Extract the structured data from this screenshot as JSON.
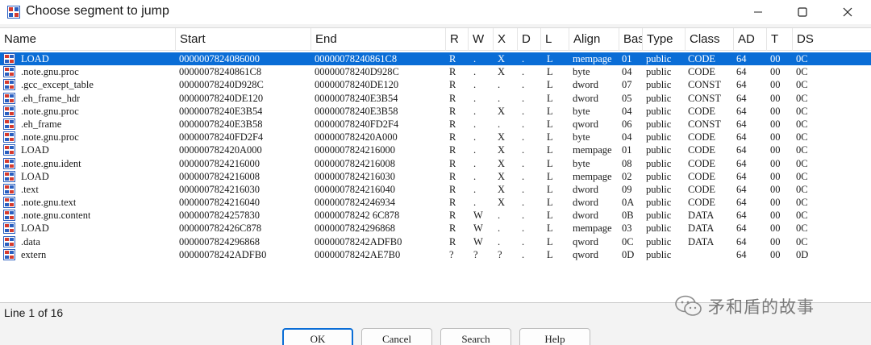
{
  "window": {
    "title": "Choose segment to jump"
  },
  "columns": [
    "Name",
    "Start",
    "End",
    "R",
    "W",
    "X",
    "D",
    "L",
    "Align",
    "Bas",
    "Type",
    "Class",
    "AD",
    "T",
    "DS"
  ],
  "rows": [
    [
      "LOAD",
      "0000007824086000",
      "00000078240861C8",
      "R",
      ".",
      "X",
      ".",
      "L",
      "mempage",
      "01",
      "public",
      "CODE",
      "64",
      "00",
      "0C"
    ],
    [
      ".note.gnu.proc",
      "00000078240861C8",
      "00000078240D928C",
      "R",
      ".",
      "X",
      ".",
      "L",
      "byte",
      "04",
      "public",
      "CODE",
      "64",
      "00",
      "0C"
    ],
    [
      ".gcc_except_table",
      "00000078240D928C",
      "00000078240DE120",
      "R",
      ".",
      ".",
      ".",
      "L",
      "dword",
      "07",
      "public",
      "CONST",
      "64",
      "00",
      "0C"
    ],
    [
      ".eh_frame_hdr",
      "00000078240DE120",
      "00000078240E3B54",
      "R",
      ".",
      ".",
      ".",
      "L",
      "dword",
      "05",
      "public",
      "CONST",
      "64",
      "00",
      "0C"
    ],
    [
      ".note.gnu.proc",
      "00000078240E3B54",
      "00000078240E3B58",
      "R",
      ".",
      "X",
      ".",
      "L",
      "byte",
      "04",
      "public",
      "CODE",
      "64",
      "00",
      "0C"
    ],
    [
      ".eh_frame",
      "00000078240E3B58",
      "00000078240FD2F4",
      "R",
      ".",
      ".",
      ".",
      "L",
      "qword",
      "06",
      "public",
      "CONST",
      "64",
      "00",
      "0C"
    ],
    [
      ".note.gnu.proc",
      "00000078240FD2F4",
      "000000782420A000",
      "R",
      ".",
      "X",
      ".",
      "L",
      "byte",
      "04",
      "public",
      "CODE",
      "64",
      "00",
      "0C"
    ],
    [
      "LOAD",
      "000000782420A000",
      "0000007824216000",
      "R",
      ".",
      "X",
      ".",
      "L",
      "mempage",
      "01",
      "public",
      "CODE",
      "64",
      "00",
      "0C"
    ],
    [
      ".note.gnu.ident",
      "0000007824216000",
      "0000007824216008",
      "R",
      ".",
      "X",
      ".",
      "L",
      "byte",
      "08",
      "public",
      "CODE",
      "64",
      "00",
      "0C"
    ],
    [
      "LOAD",
      "0000007824216008",
      "0000007824216030",
      "R",
      ".",
      "X",
      ".",
      "L",
      "mempage",
      "02",
      "public",
      "CODE",
      "64",
      "00",
      "0C"
    ],
    [
      ".text",
      "0000007824216030",
      "0000007824216040",
      "R",
      ".",
      "X",
      ".",
      "L",
      "dword",
      "09",
      "public",
      "CODE",
      "64",
      "00",
      "0C"
    ],
    [
      ".note.gnu.text",
      "0000007824216040",
      "0000007824246934",
      "R",
      ".",
      "X",
      ".",
      "L",
      "dword",
      "0A",
      "public",
      "CODE",
      "64",
      "00",
      "0C"
    ],
    [
      ".note.gnu.content",
      "0000007824257830",
      "00000078242 6C878",
      "R",
      "W",
      ".",
      ".",
      "L",
      "dword",
      "0B",
      "public",
      "DATA",
      "64",
      "00",
      "0C"
    ],
    [
      "LOAD",
      "000000782426C878",
      "0000007824296868",
      "R",
      "W",
      ".",
      ".",
      "L",
      "mempage",
      "03",
      "public",
      "DATA",
      "64",
      "00",
      "0C"
    ],
    [
      ".data",
      "0000007824296868",
      "00000078242ADFB0",
      "R",
      "W",
      ".",
      ".",
      "L",
      "qword",
      "0C",
      "public",
      "DATA",
      "64",
      "00",
      "0C"
    ],
    [
      "extern",
      "00000078242ADFB0",
      "00000078242AE7B0",
      "?",
      "?",
      "?",
      ".",
      "L",
      "qword",
      "0D",
      "public",
      "",
      "64",
      "00",
      "0D"
    ]
  ],
  "status": {
    "line": "Line 1 of 16"
  },
  "watermark": {
    "text": "矛和盾的故事"
  },
  "buttons": {
    "ok": "OK",
    "cancel": "Cancel",
    "search": "Search",
    "help": "Help"
  },
  "colors": {
    "selection": "#0a6dd6",
    "icon_red": "#d63a2e",
    "icon_blue": "#2a5fc0"
  }
}
